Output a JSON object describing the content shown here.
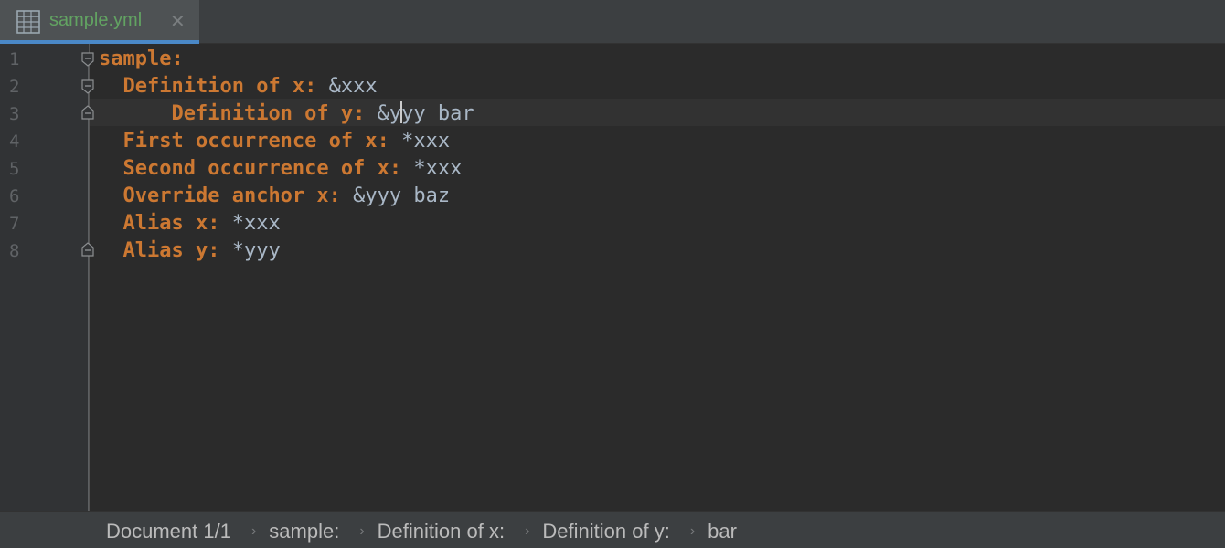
{
  "tab": {
    "filename": "sample.yml",
    "close": "✕",
    "icon": "yaml-file-icon"
  },
  "editor": {
    "lines": [
      {
        "number": "1",
        "indent": "",
        "key": "sample:",
        "value": ""
      },
      {
        "number": "2",
        "indent": "  ",
        "key": "Definition of x:",
        "value": " &xxx"
      },
      {
        "number": "3",
        "indent": "      ",
        "key": "Definition of y:",
        "value_before_caret": " &y",
        "value_after_caret": "yy bar"
      },
      {
        "number": "4",
        "indent": "  ",
        "key": "First occurrence of x:",
        "value": " *xxx"
      },
      {
        "number": "5",
        "indent": "  ",
        "key": "Second occurrence of x:",
        "value": " *xxx"
      },
      {
        "number": "6",
        "indent": "  ",
        "key": "Override anchor x:",
        "value": " &yyy baz"
      },
      {
        "number": "7",
        "indent": "  ",
        "key": "Alias x:",
        "value": " *xxx"
      },
      {
        "number": "8",
        "indent": "  ",
        "key": "Alias y:",
        "value": " *yyy"
      }
    ],
    "caret_line": 3
  },
  "breadcrumbs": [
    "Document 1/1",
    "sample:",
    "Definition of x:",
    "Definition of y:",
    "bar"
  ],
  "breadcrumb_separator": "›",
  "colors": {
    "background": "#2b2b2b",
    "key": "#cc7832",
    "value": "#a9b7c6",
    "tab_active_underline": "#4a88c7",
    "filename": "#62a362"
  }
}
